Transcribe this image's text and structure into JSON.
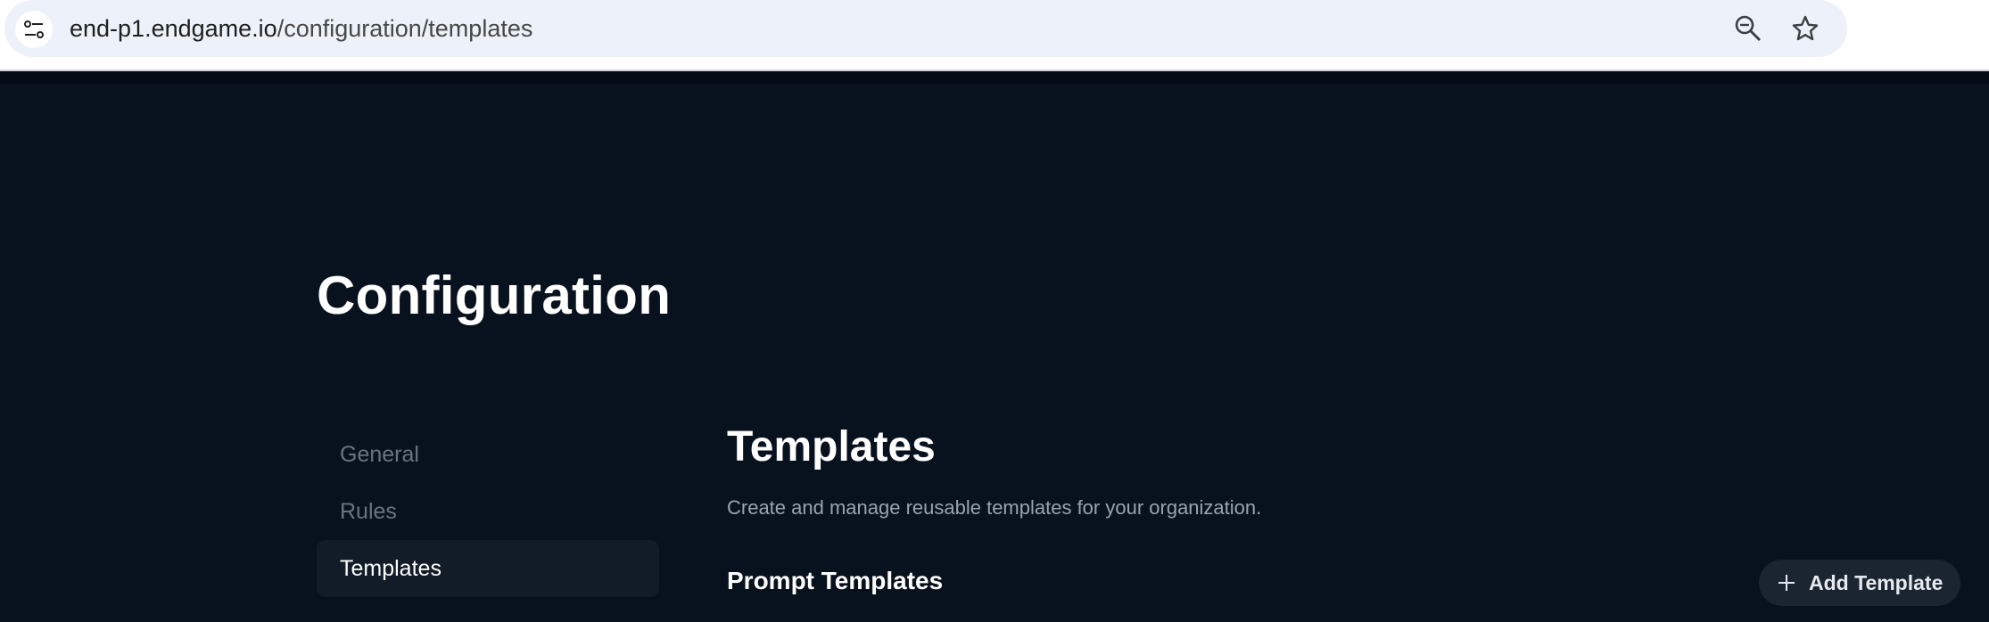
{
  "browser": {
    "url_host": "end-p1.endgame.io",
    "url_path": "/configuration/templates",
    "icons": [
      "tune-icon",
      "zoom-out-icon",
      "star-icon"
    ]
  },
  "page": {
    "title": "Configuration"
  },
  "sidebar": {
    "items": [
      {
        "label": "General",
        "active": false
      },
      {
        "label": "Rules",
        "active": false
      },
      {
        "label": "Templates",
        "active": true
      }
    ]
  },
  "main": {
    "title": "Templates",
    "description": "Create and manage reusable templates for your organization.",
    "section_title": "Prompt Templates",
    "add_button_label": "Add Template",
    "add_button_icon": "plus-icon"
  },
  "colors": {
    "background": "#08121e",
    "active_nav_bg": "#121c28",
    "button_bg": "#1b2531",
    "muted_text": "#6b7381"
  }
}
